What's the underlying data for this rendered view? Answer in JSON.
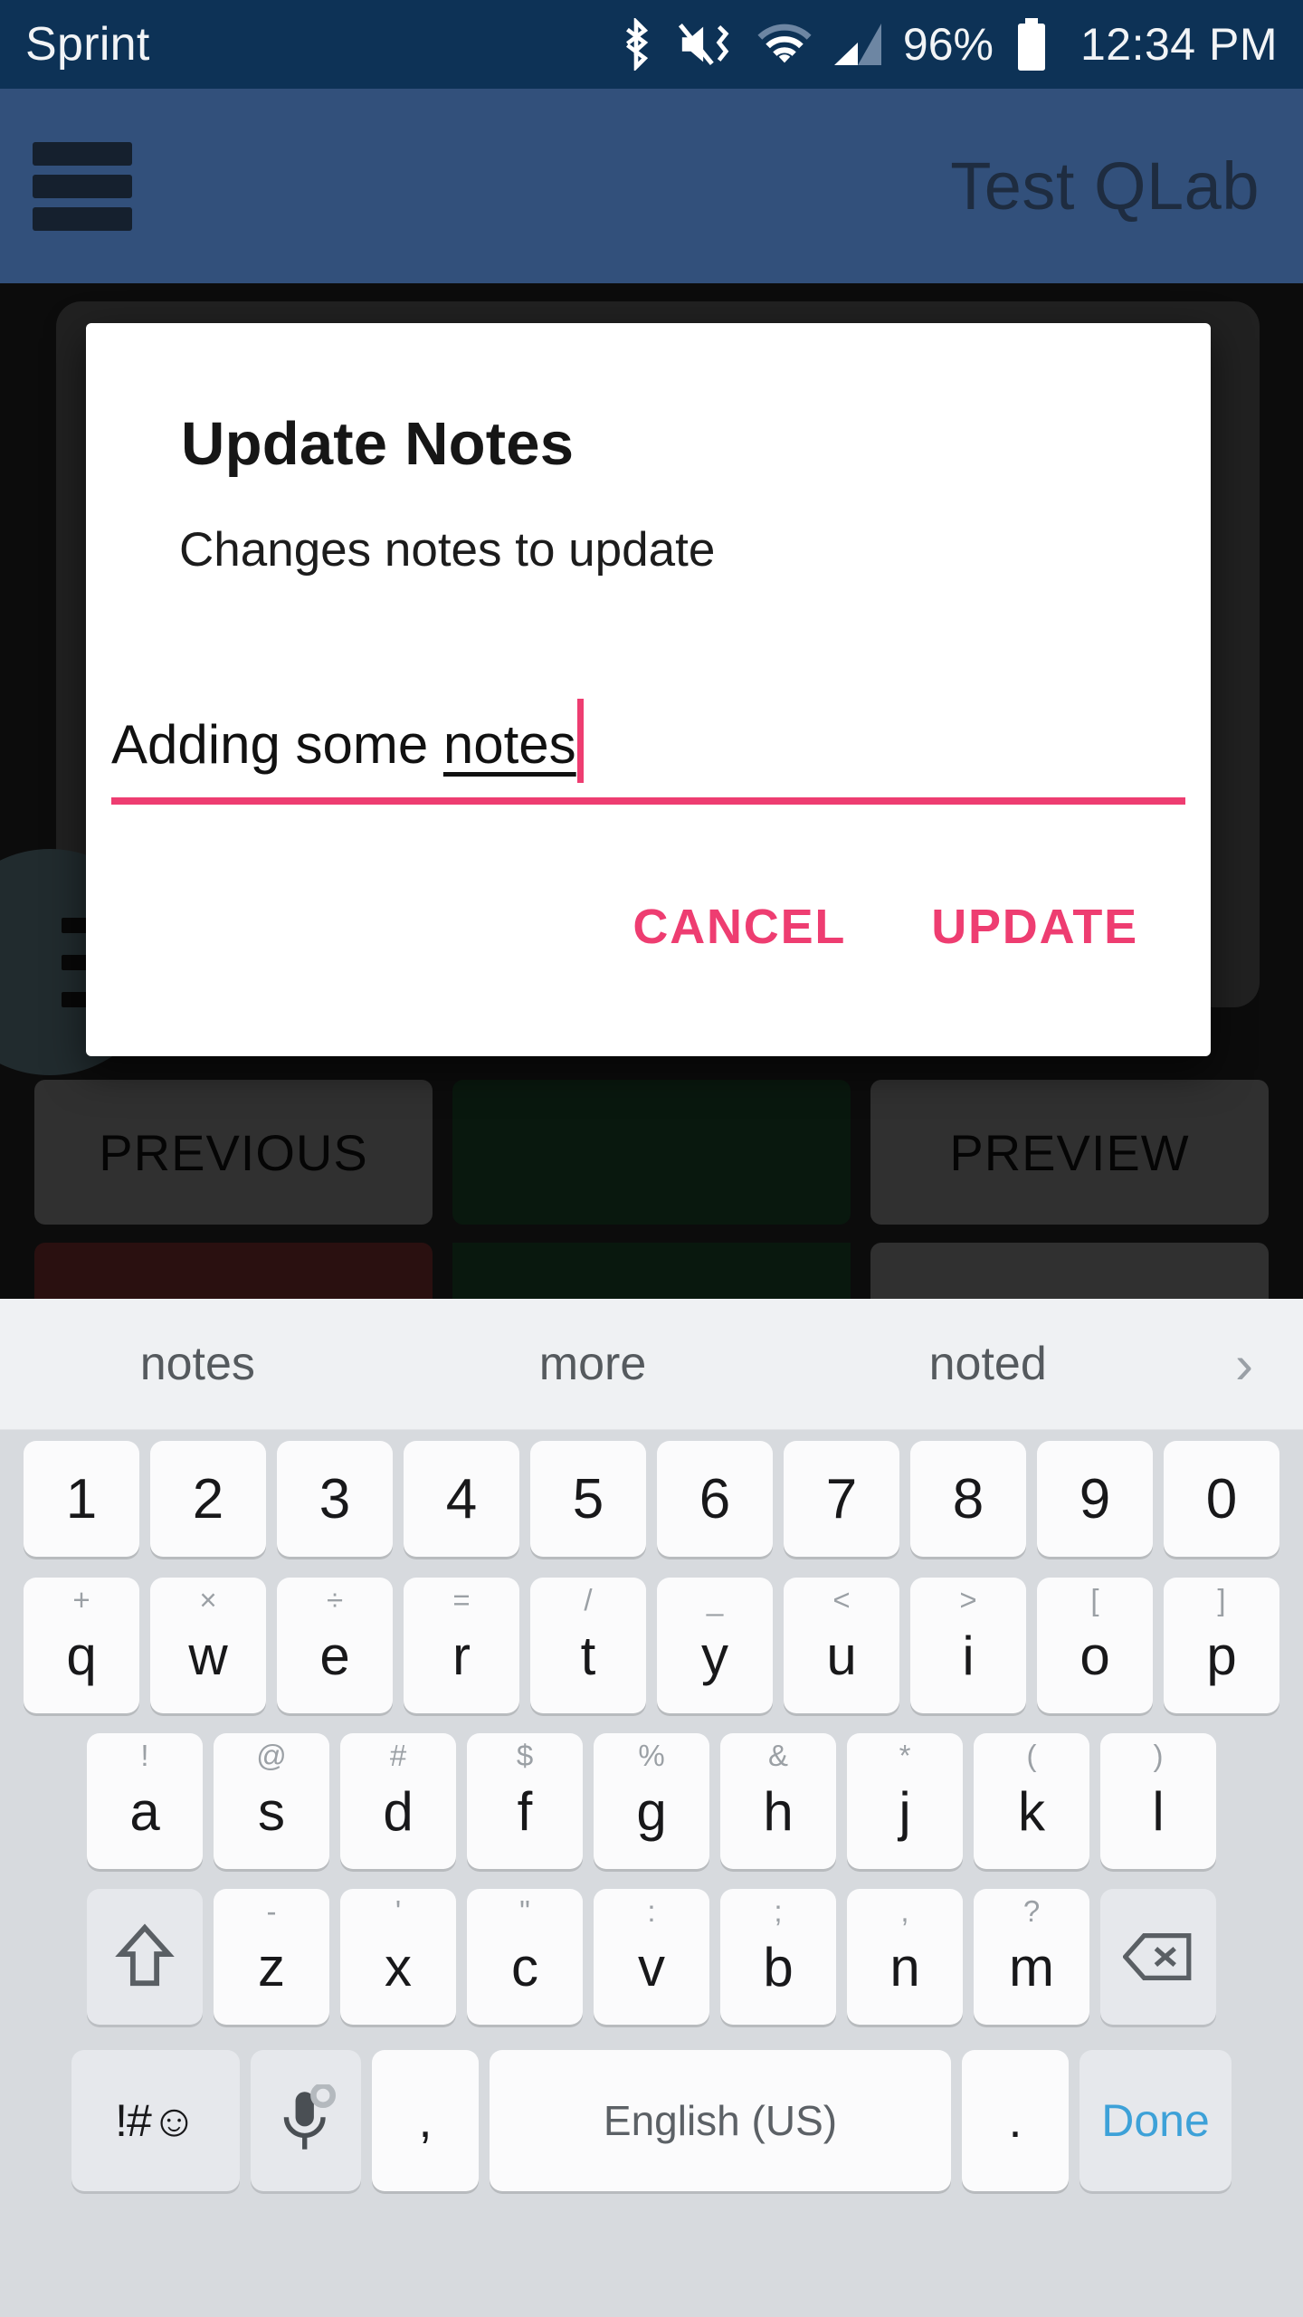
{
  "status_bar": {
    "carrier": "Sprint",
    "battery_percent": "96%",
    "time": "12:34 PM",
    "icons": [
      "bluetooth-icon",
      "vibrate-mute-icon",
      "wifi-icon",
      "cellular-signal-icon",
      "battery-icon"
    ],
    "background_color": "#0d3256"
  },
  "app_bar": {
    "menu_icon": "hamburger-menu-icon",
    "title": "Test QLab",
    "background_color": "#32507b"
  },
  "app_body": {
    "fab_icon": "list-lines-icon",
    "buttons": [
      {
        "label": "PREVIOUS",
        "color": "#6b6b6b"
      },
      {
        "label": "",
        "color": "#143521"
      },
      {
        "label": "PREVIEW",
        "color": "#6b6b6b"
      }
    ],
    "buttons_row2": [
      {
        "label": "",
        "color": "#5d2424"
      },
      {
        "label": "",
        "color": "#143521"
      },
      {
        "label": "",
        "color": "#6b6b6b"
      }
    ]
  },
  "dialog": {
    "title": "Update Notes",
    "message": "Changes notes to update",
    "input": {
      "value_plain": "Adding some ",
      "value_composing": "notes",
      "full_value": "Adding some notes",
      "underline_color": "#ee3d71",
      "caret_color": "#ee3d71"
    },
    "cancel_label": "CANCEL",
    "update_label": "UPDATE",
    "accent_color": "#ee3d71"
  },
  "keyboard": {
    "suggestions": [
      "notes",
      "more",
      "noted"
    ],
    "suggestion_more_icon": "chevron-right-icon",
    "row_numbers": [
      "1",
      "2",
      "3",
      "4",
      "5",
      "6",
      "7",
      "8",
      "9",
      "0"
    ],
    "row_top": [
      {
        "main": "q",
        "alt": "+"
      },
      {
        "main": "w",
        "alt": "×"
      },
      {
        "main": "e",
        "alt": "÷"
      },
      {
        "main": "r",
        "alt": "="
      },
      {
        "main": "t",
        "alt": "/"
      },
      {
        "main": "y",
        "alt": "_"
      },
      {
        "main": "u",
        "alt": "<"
      },
      {
        "main": "i",
        "alt": ">"
      },
      {
        "main": "o",
        "alt": "["
      },
      {
        "main": "p",
        "alt": "]"
      }
    ],
    "row_home": [
      {
        "main": "a",
        "alt": "!"
      },
      {
        "main": "s",
        "alt": "@"
      },
      {
        "main": "d",
        "alt": "#"
      },
      {
        "main": "f",
        "alt": "$"
      },
      {
        "main": "g",
        "alt": "%"
      },
      {
        "main": "h",
        "alt": "&"
      },
      {
        "main": "j",
        "alt": "*"
      },
      {
        "main": "k",
        "alt": "("
      },
      {
        "main": "l",
        "alt": ")"
      }
    ],
    "row_bottom": [
      {
        "main": "z",
        "alt": "-"
      },
      {
        "main": "x",
        "alt": "'"
      },
      {
        "main": "c",
        "alt": "\""
      },
      {
        "main": "v",
        "alt": ":"
      },
      {
        "main": "b",
        "alt": ";"
      },
      {
        "main": "n",
        "alt": ","
      },
      {
        "main": "m",
        "alt": "?"
      }
    ],
    "shift_icon": "shift-arrow-icon",
    "backspace_icon": "backspace-icon",
    "symbols_label": "!#☺",
    "mic_icon": "microphone-icon",
    "settings_icon": "gear-icon",
    "comma_label": ",",
    "space_label": "English (US)",
    "period_label": ".",
    "done_label": "Done",
    "done_color": "#3da1d8",
    "background_color": "#d7dade"
  }
}
